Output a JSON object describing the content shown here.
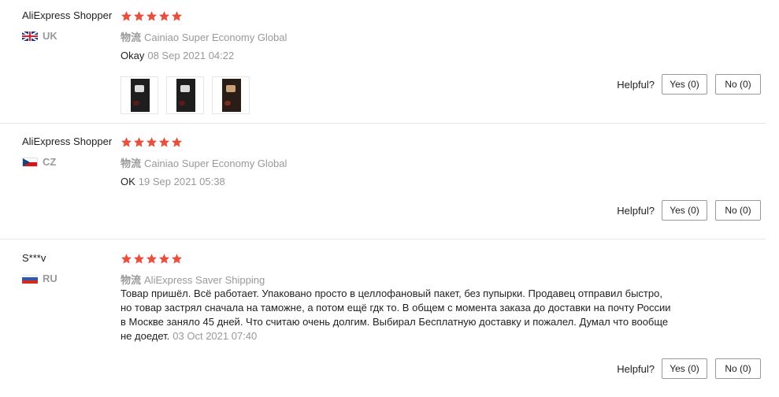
{
  "colors": {
    "star": "#e8503d",
    "muted_text": "#999999",
    "border": "#e6e6e6"
  },
  "reviews": [
    {
      "user": "AliExpress Shopper",
      "country_code": "UK",
      "flag_icon": "uk-flag-icon",
      "stars": 5,
      "shipping_prefix": "物流",
      "shipping_method": "Cainiao Super Economy Global",
      "text": "Okay",
      "date": "08 Sep 2021 04:22",
      "photos": [
        "photo-1",
        "photo-2",
        "photo-3"
      ],
      "helpful_label": "Helpful?",
      "yes_label": "Yes (0)",
      "no_label": "No (0)"
    },
    {
      "user": "AliExpress Shopper",
      "country_code": "CZ",
      "flag_icon": "cz-flag-icon",
      "stars": 5,
      "shipping_prefix": "物流",
      "shipping_method": "Cainiao Super Economy Global",
      "text": "OK",
      "date": "19 Sep 2021 05:38",
      "helpful_label": "Helpful?",
      "yes_label": "Yes (0)",
      "no_label": "No (0)"
    },
    {
      "user": "S***v",
      "country_code": "RU",
      "flag_icon": "ru-flag-icon",
      "stars": 5,
      "shipping_prefix": "物流",
      "shipping_method": "AliExpress Saver Shipping",
      "text": "Товар пришёл. Всё работает. Упаковано просто в целлофановый пакет, без пупырки. Продавец отправил быстро, но товар застрял сначала на таможне, а потом ещё гдк то. В общем с момента заказа до доставки на почту России в Москве заняло 45 дней. Что считаю очень долгим. Выбирал Бесплатную доставку и пожалел. Думал что вообще не доедет.",
      "date": "03 Oct 2021 07:40",
      "helpful_label": "Helpful?",
      "yes_label": "Yes (0)",
      "no_label": "No (0)"
    }
  ]
}
